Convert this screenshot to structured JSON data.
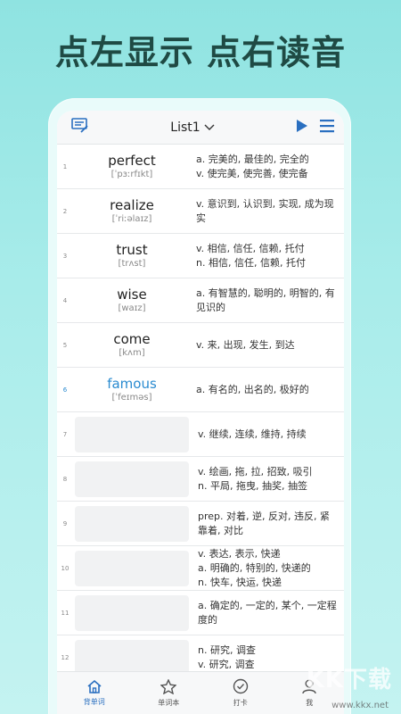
{
  "headline": "点左显示 点右读音",
  "topbar": {
    "list_title": "List1"
  },
  "rows": [
    {
      "num": "1",
      "word": "perfect",
      "phonetic": "[ˈpɜːrfɪkt]",
      "defs": [
        "a. 完美的, 最佳的, 完全的",
        "v. 使完美, 使完善, 使完备"
      ]
    },
    {
      "num": "2",
      "word": "realize",
      "phonetic": "[ˈriːəlaɪz]",
      "defs": [
        "v. 意识到, 认识到, 实现, 成为现实"
      ]
    },
    {
      "num": "3",
      "word": "trust",
      "phonetic": "[trʌst]",
      "defs": [
        "v. 相信, 信任, 信赖, 托付",
        "n. 相信, 信任, 信赖, 托付"
      ]
    },
    {
      "num": "4",
      "word": "wise",
      "phonetic": "[waɪz]",
      "defs": [
        "a. 有智慧的, 聪明的, 明智的, 有见识的"
      ]
    },
    {
      "num": "5",
      "word": "come",
      "phonetic": "[kʌm]",
      "defs": [
        "v. 来, 出现, 发生, 到达"
      ]
    },
    {
      "num": "6",
      "word": "famous",
      "phonetic": "[ˈfeɪməs]",
      "defs": [
        "a. 有名的, 出名的, 极好的"
      ],
      "highlight": true
    },
    {
      "num": "7",
      "word": "",
      "phonetic": "",
      "defs": [
        "v. 继续, 连续, 维持, 持续"
      ]
    },
    {
      "num": "8",
      "word": "",
      "phonetic": "",
      "defs": [
        "v. 绘画, 拖, 拉, 招致, 吸引",
        "n. 平局, 拖曳, 抽奖, 抽签"
      ]
    },
    {
      "num": "9",
      "word": "",
      "phonetic": "",
      "defs": [
        "prep. 对着, 逆, 反对, 违反, 紧靠着, 对比"
      ]
    },
    {
      "num": "10",
      "word": "",
      "phonetic": "",
      "defs": [
        "v. 表达, 表示, 快递",
        "a. 明确的, 特别的, 快递的",
        "n. 快车, 快运, 快递"
      ]
    },
    {
      "num": "11",
      "word": "",
      "phonetic": "",
      "defs": [
        "a. 确定的, 一定的, 某个, 一定程度的"
      ]
    },
    {
      "num": "12",
      "word": "",
      "phonetic": "",
      "defs": [
        "n. 研究, 调查",
        "v. 研究, 调查"
      ]
    }
  ],
  "tabs": [
    {
      "label": "背单词",
      "icon": "home-icon",
      "active": true
    },
    {
      "label": "单词本",
      "icon": "star-icon",
      "active": false
    },
    {
      "label": "打卡",
      "icon": "checkin-icon",
      "active": false
    },
    {
      "label": "我",
      "icon": "user-icon",
      "active": false
    }
  ],
  "watermark": {
    "text": "KK下载",
    "url": "www.kkx.net"
  },
  "colors": {
    "accent": "#2a8bd0",
    "headline": "#1f4a44",
    "active_tab": "#2a6fc0"
  }
}
